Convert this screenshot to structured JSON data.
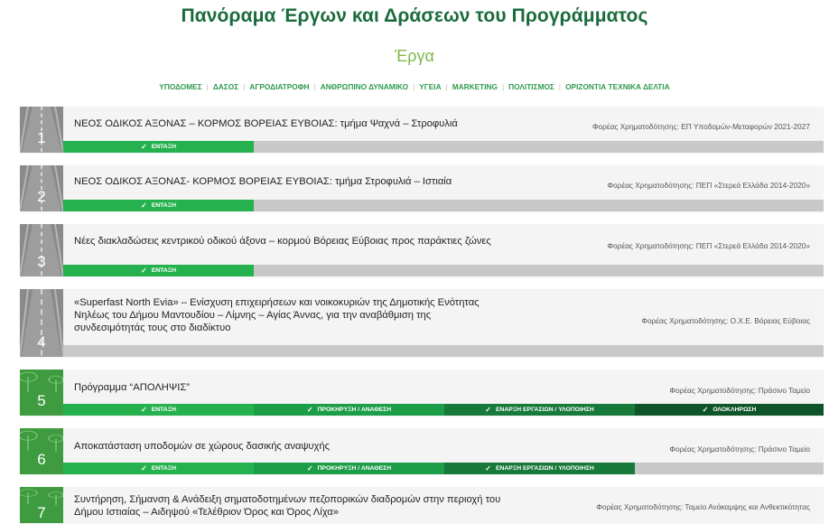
{
  "header": {
    "title": "Πανόραμα Έργων και Δράσεων του Προγράμματος",
    "subtitle": "Έργα"
  },
  "categories": [
    "ΥΠΟΔΟΜΕΣ",
    "ΔΑΣΟΣ",
    "ΑΓΡΟΔΙΑΤΡΟΦΗ",
    "ΑΝΘΡΩΠΙΝΟ ΔΥΝΑΜΙΚΟ",
    "ΥΓΕΙΑ",
    "MARKETING",
    "ΠΟΛΙΤΙΣΜΟΣ",
    "ΟΡΙΖΟΝΤΙΑ ΤΕΧΝΙΚΑ ΔΕΛΤΙΑ"
  ],
  "status_labels": [
    "ΕΝΤΑΞΗ",
    "ΠΡΟΚΗΡΥΞΗ / ΑΝΑΘΕΣΗ",
    "ΕΝΑΡΞΗ ΕΡΓΑΣΙΩΝ / ΥΛΟΠΟΙΗΣΗ",
    "ΟΛΟΚΛΗΡΩΣΗ"
  ],
  "projects": [
    {
      "number": "1",
      "title": "ΝΕΟΣ ΟΔΙΚΟΣ ΑΞΟΝΑΣ – ΚΟΡΜΟΣ ΒΟΡΕΙΑΣ ΕΥΒΟΙΑΣ: τμήμα Ψαχνά – Στροφυλιά",
      "funding": "Φορέας Χρηματοδότησης: ΕΠ Υποδομών-Μεταφορών 2021-2027",
      "tile": "road",
      "stages_completed": 1
    },
    {
      "number": "2",
      "title": "ΝΕΟΣ ΟΔΙΚΟΣ ΑΞΟΝΑΣ- ΚΟΡΜΟΣ ΒΟΡΕΙΑΣ ΕΥΒΟΙΑΣ: τμήμα Στροφυλιά – Ιστιαία",
      "funding": "Φορέας Χρηματοδότησης: ΠΕΠ «Στερεά Ελλάδα 2014-2020»",
      "tile": "road",
      "stages_completed": 1
    },
    {
      "number": "3",
      "title": "Νέες διακλαδώσεις κεντρικού οδικού άξονα – κορμού Βόρειας Εύβοιας προς παράκτιες ζώνες",
      "funding": "Φορέας Χρηματοδότησης: ΠΕΠ «Στερεά Ελλάδα 2014-2020»",
      "tile": "road",
      "stages_completed": 1
    },
    {
      "number": "4",
      "title": "«Superfast North Evia» – Ενίσχυση επιχειρήσεων και νοικοκυριών της Δημοτικής Ενότητας Νηλέως του Δήμου Μαντουδίου – Λίμνης – Αγίας Άννας, για την αναβάθμιση της συνδεσιμότητάς τους στο διαδίκτυο",
      "funding": "Φορέας Χρηματοδότησης: Ο.Χ.Ε. Βόρειας Εύβοιας",
      "tile": "road",
      "stages_completed": 0
    },
    {
      "number": "5",
      "title": "Πρόγραμμα “ΑΠΟΛΗΨΙΣ”",
      "funding": "Φορέας Χρηματοδότησης: Πράσινο Ταμείο",
      "tile": "tree",
      "stages_completed": 4
    },
    {
      "number": "6",
      "title": "Αποκατάσταση υποδομών σε χώρους δασικής αναψυχής",
      "funding": "Φορέας Χρηματοδότησης: Πράσινο Ταμείο",
      "tile": "tree",
      "stages_completed": 3
    },
    {
      "number": "7",
      "title": "Συντήρηση, Σήμανση & Ανάδειξη σηματοδοτημένων πεζοπορικών διαδρομών στην περιοχή του Δήμου Ιστιαίας – Αιδηψού «Τελέθριον Όρος και Όρος Λίχα»",
      "funding": "Φορέας Χρηματοδότησης: Ταμείο Ανάκαμψης και Ανθεκτικότητας",
      "tile": "tree",
      "stages_completed": 0
    }
  ]
}
